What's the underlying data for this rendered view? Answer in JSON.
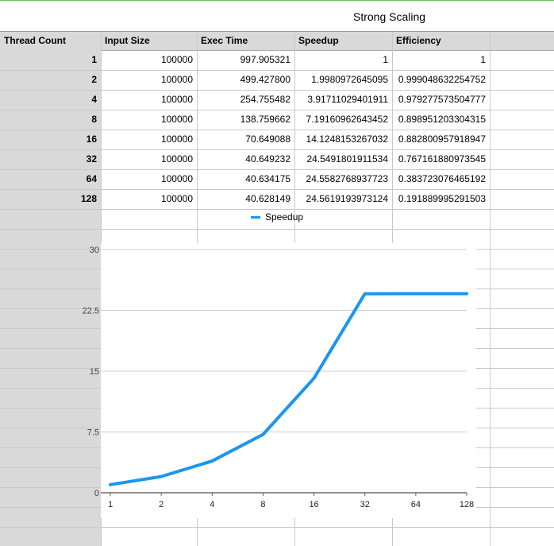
{
  "sheet": {
    "title": "Strong Scaling"
  },
  "table": {
    "columns": [
      "Thread Count",
      "Input Size",
      "Exec Time",
      "Speedup",
      "Efficiency"
    ],
    "rows": [
      [
        "1",
        "100000",
        "997.905321",
        "1",
        "1"
      ],
      [
        "2",
        "100000",
        "499.427800",
        "1.9980972645095",
        "0.999048632254752"
      ],
      [
        "4",
        "100000",
        "254.755482",
        "3.91711029401911",
        "0.979277573504777"
      ],
      [
        "8",
        "100000",
        "138.759662",
        "7.19160962643452",
        "0.898951203304315"
      ],
      [
        "16",
        "100000",
        "70.649088",
        "14.1248153267032",
        "0.882800957918947"
      ],
      [
        "32",
        "100000",
        "40.649232",
        "24.5491801911534",
        "0.767161880973545"
      ],
      [
        "64",
        "100000",
        "40.634175",
        "24.5582768937723",
        "0.383723076465192"
      ],
      [
        "128",
        "100000",
        "40.628149",
        "24.5619193973124",
        "0.191889995291503"
      ]
    ]
  },
  "chart_data": {
    "type": "line",
    "title": "",
    "xlabel": "",
    "ylabel": "",
    "categories": [
      "1",
      "2",
      "4",
      "8",
      "16",
      "32",
      "64",
      "128"
    ],
    "series": [
      {
        "name": "Speedup",
        "values": [
          1,
          1.998,
          3.917,
          7.192,
          14.125,
          24.549,
          24.558,
          24.562
        ]
      }
    ],
    "ylim": [
      0,
      30
    ],
    "yticks": [
      "0",
      "7.5",
      "15",
      "22.5",
      "30"
    ],
    "legend": "top",
    "grid": true,
    "line_color": "#1997f0"
  }
}
